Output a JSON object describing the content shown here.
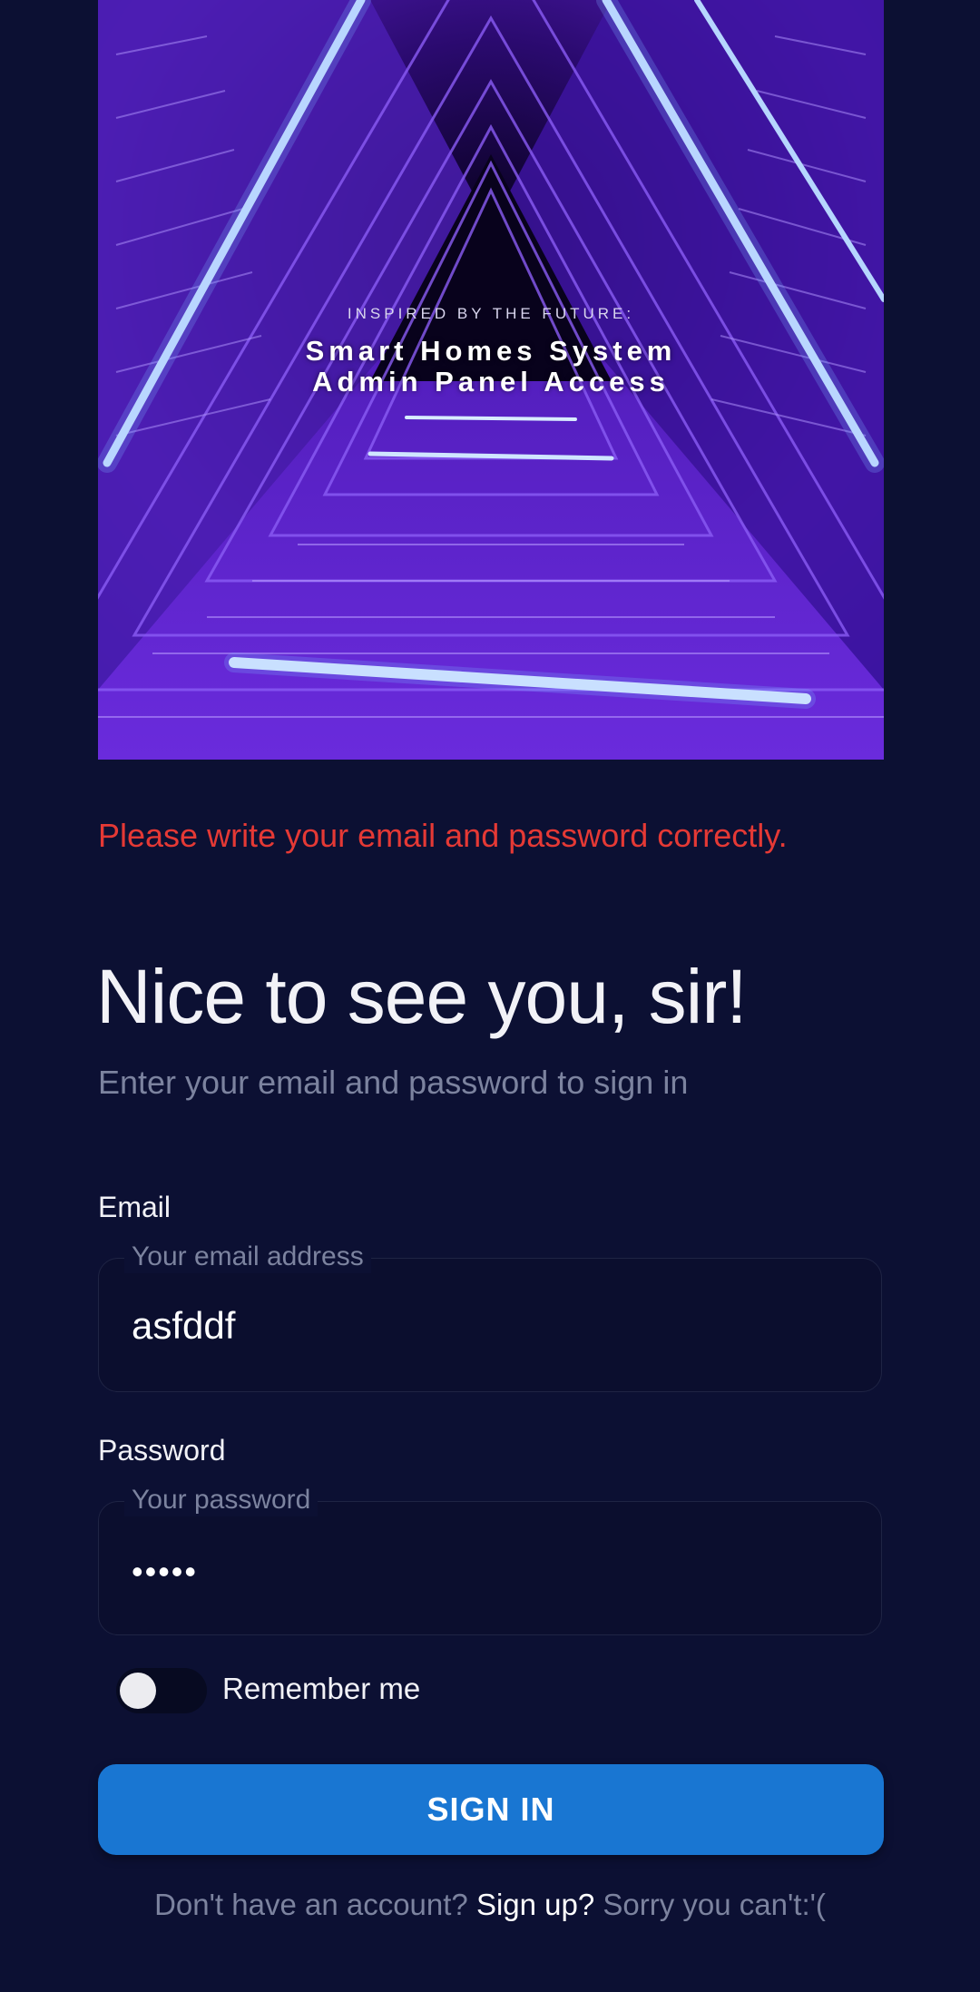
{
  "hero": {
    "kicker": "INSPIRED BY THE FUTURE:",
    "title_line1": "Smart Homes System",
    "title_line2": "Admin Panel Access"
  },
  "error_message": "Please write your email and password correctly.",
  "heading": "Nice to see you, sir!",
  "subheading": "Enter your email and password to sign in",
  "email": {
    "label": "Email",
    "placeholder": "Your email address",
    "value": "asfddf"
  },
  "password": {
    "label": "Password",
    "placeholder": "Your password",
    "masked_value": "•••••"
  },
  "remember": {
    "label": "Remember me",
    "checked": false
  },
  "signin_label": "SIGN IN",
  "footer": {
    "prefix": "Don't have an account? ",
    "link": "Sign up?",
    "suffix": " Sorry you can't:'("
  },
  "colors": {
    "background": "#0c1033",
    "error": "#e53935",
    "primary": "#1976d2",
    "muted": "#7c839f"
  }
}
